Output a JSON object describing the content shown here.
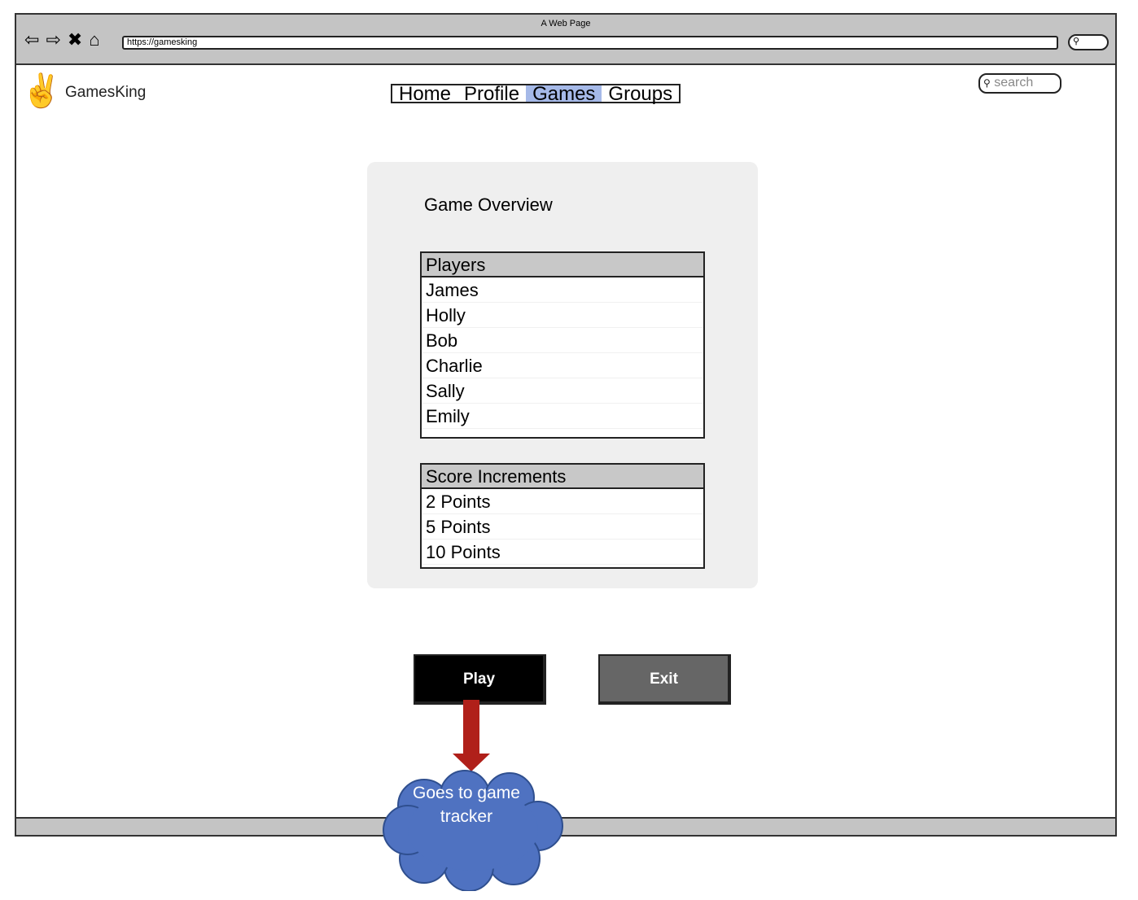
{
  "browser": {
    "title": "A Web Page",
    "url": "https://gamesking"
  },
  "header": {
    "brand": "GamesKing",
    "nav": [
      "Home",
      "Profile",
      "Games",
      "Groups"
    ],
    "active": "Games",
    "search_placeholder": "search"
  },
  "overview": {
    "title": "Game Overview",
    "players": {
      "header": "Players",
      "items": [
        "James",
        "Holly",
        "Bob",
        "Charlie",
        "Sally",
        "Emily"
      ]
    },
    "scores": {
      "header": "Score Increments",
      "items": [
        "2 Points",
        "5 Points",
        "10 Points"
      ]
    }
  },
  "buttons": {
    "play": "Play",
    "exit": "Exit"
  },
  "annotation": {
    "note": "Goes to game tracker"
  },
  "colors": {
    "nav_active": "#a5b9e8",
    "cloud": "#4f72c1",
    "arrow": "#b0201a"
  }
}
